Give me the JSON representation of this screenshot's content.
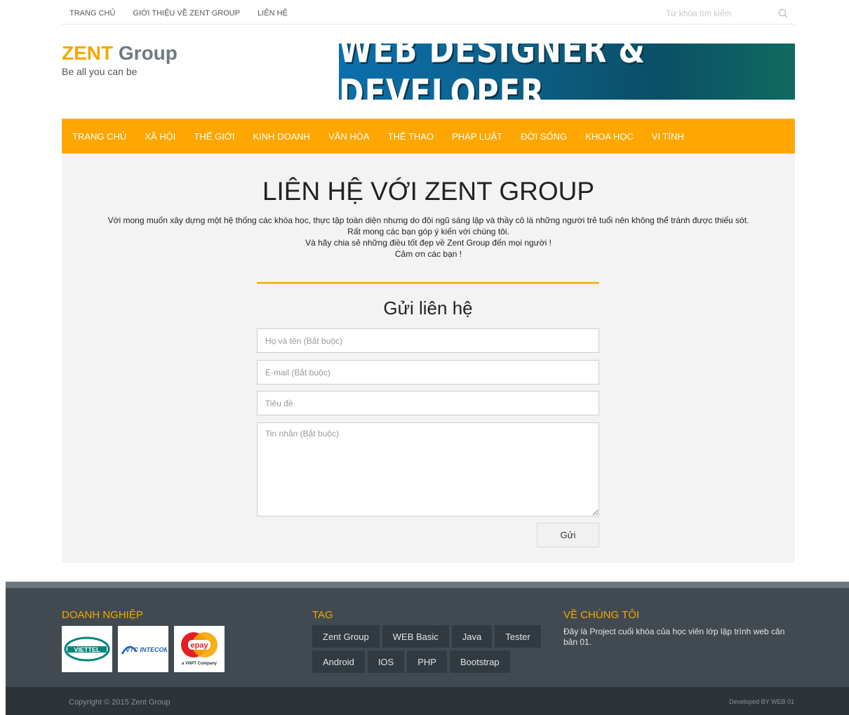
{
  "topbar": {
    "links": [
      "TRANG CHỦ",
      "GIỚI THIỆU VỀ ZENT GROUP",
      "LIÊN HỆ"
    ],
    "search_placeholder": "Từ khóa tìm kiếm"
  },
  "logo": {
    "brand": "ZENT",
    "brand2": " Group",
    "tagline": "Be all you can be"
  },
  "banner": {
    "text": "WEB DESIGNER & DEVELOPER"
  },
  "mainnav": {
    "items": [
      "TRANG CHỦ",
      "XÃ HỘI",
      "THẾ GIỚI",
      "KINH DOANH",
      "VĂN HÓA",
      "THỂ THAO",
      "PHÁP LUẬT",
      "ĐỜI SỐNG",
      "KHOA HỌC",
      "VI TÍNH"
    ]
  },
  "content": {
    "title": "LIÊN HỆ VỚI ZENT GROUP",
    "intro": [
      "Với mong muốn xây dựng một hệ thống các khóa học, thực tập toàn diện nhưng do đội ngũ sáng lập và thầy cô là những người trẻ tuổi nên không thể tránh được thiếu sót.",
      "Rất mong các bạn góp ý kiến với chúng tôi.",
      "Và hãy chia sẻ những điều tốt đẹp về Zent Group đến mọi người !",
      "Cảm ơn các bạn !"
    ]
  },
  "form": {
    "title": "Gửi liên hệ",
    "name_placeholder": "Họ và tên (Bắt buộc)",
    "email_placeholder": "E-mail (Bắt buộc)",
    "subject_placeholder": "Tiêu đề",
    "message_placeholder": "Tin nhắn (Bắt buộc)",
    "submit_label": "Gửi"
  },
  "footer": {
    "col1_title": "DOANH NGHIỆP",
    "col2_title": "TAG",
    "col3_title": "VỀ CHÚNG TÔI",
    "partners": [
      "VIETTEL",
      "VTC INTECOM",
      "epay",
      "a VNPT Company"
    ],
    "tags": [
      "Zent Group",
      "WEB Basic",
      "Java",
      "Tester",
      "Android",
      "IOS",
      "PHP",
      "Bootstrap"
    ],
    "about": "Đây là Project cuối khóa của học viên lớp lập trình web căn bản 01.",
    "copyright_prefix": "Copyright © 2015 ",
    "copyright_brand": "Zent Group",
    "developed": "Developed BY WEB 01"
  },
  "colors": {
    "accent": "#ffa600",
    "brand_text": "#f5a800",
    "footer_bg": "#414a51",
    "bottom_bg": "#2d3338"
  }
}
